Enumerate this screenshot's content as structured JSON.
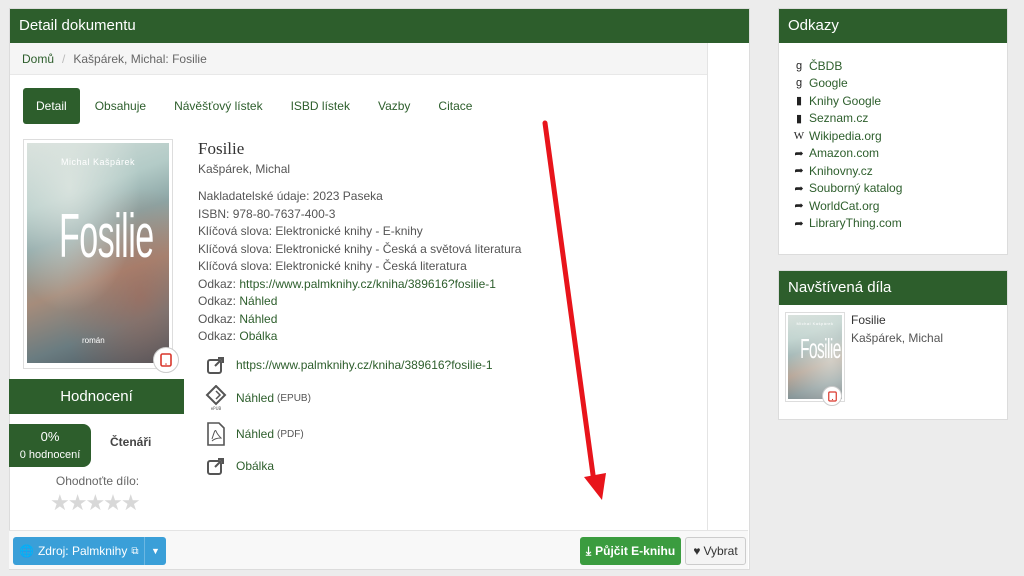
{
  "main": {
    "heading": "Detail dokumentu",
    "breadcrumb": {
      "home": "Domů",
      "current": "Kašpárek, Michal: Fosilie"
    },
    "tabs": [
      "Detail",
      "Obsahuje",
      "Návěšťový lístek",
      "ISBD lístek",
      "Vazby",
      "Citace"
    ],
    "cover": {
      "author": "Michal Kašpárek",
      "title": "Fosilie",
      "subtitle": "román"
    },
    "rating": {
      "heading": "Hodnocení",
      "percent": "0%",
      "count": "0 hodnocení",
      "readers": "Čtenáři",
      "rate_label": "Ohodnoťte dílo:",
      "stars": "★★★★★"
    },
    "document": {
      "title": "Fosilie",
      "author": "Kašpárek, Michal",
      "publisher_label": "Nakladatelské údaje: ",
      "publisher": "2023 Paseka",
      "isbn_label": "ISBN: ",
      "isbn": "978-80-7637-400-3",
      "kw_label": "Klíčová slova: ",
      "keywords": [
        "Elektronické knihy - E-knihy",
        "Elektronické knihy - Česká a světová literatura",
        "Elektronické knihy - Česká literatura"
      ],
      "link_label": "Odkaz: ",
      "links": [
        "https://www.palmknihy.cz/kniha/389616?fosilie-1",
        "Náhled",
        "Náhled",
        "Obálka"
      ]
    },
    "resources": {
      "url": "https://www.palmknihy.cz/kniha/389616?fosilie-1",
      "preview_epub": "Náhled",
      "epub_tag": "(EPUB)",
      "preview_pdf": "Náhled",
      "pdf_tag": "(PDF)",
      "cover": "Obálka",
      "epub_icon_text": "ePUB"
    },
    "footer": {
      "source": "Zdroj: Palmknihy",
      "borrow": "Půjčit E-knihu",
      "select": "Vybrat"
    }
  },
  "links_panel": {
    "heading": "Odkazy",
    "items": [
      {
        "icon": "google-icon",
        "glyph": "g",
        "label": "ČBDB"
      },
      {
        "icon": "google-icon",
        "glyph": "g",
        "label": "Google"
      },
      {
        "icon": "book-icon",
        "glyph": "📖",
        "label": "Knihy Google"
      },
      {
        "icon": "book-icon",
        "glyph": "📖",
        "label": "Seznam.cz"
      },
      {
        "icon": "wikipedia-icon",
        "glyph": "W",
        "label": "Wikipedia.org"
      },
      {
        "icon": "share-icon",
        "glyph": "➦",
        "label": "Amazon.com"
      },
      {
        "icon": "share-icon",
        "glyph": "➦",
        "label": "Knihovny.cz"
      },
      {
        "icon": "share-icon",
        "glyph": "➦",
        "label": "Souborný katalog"
      },
      {
        "icon": "share-icon",
        "glyph": "➦",
        "label": "WorldCat.org"
      },
      {
        "icon": "share-icon",
        "glyph": "➦",
        "label": "LibraryThing.com"
      }
    ]
  },
  "visited_panel": {
    "heading": "Navštívená díla",
    "item": {
      "title": "Fosilie",
      "author": "Kašpárek, Michal",
      "cover_title": "Fosilie",
      "cover_author": "Michal Kašpárek"
    }
  },
  "colors": {
    "brand": "#2d5e2c",
    "borrow": "#3b9c3f",
    "source": "#3a9fd8",
    "annotation_arrow": "#e8141b"
  }
}
